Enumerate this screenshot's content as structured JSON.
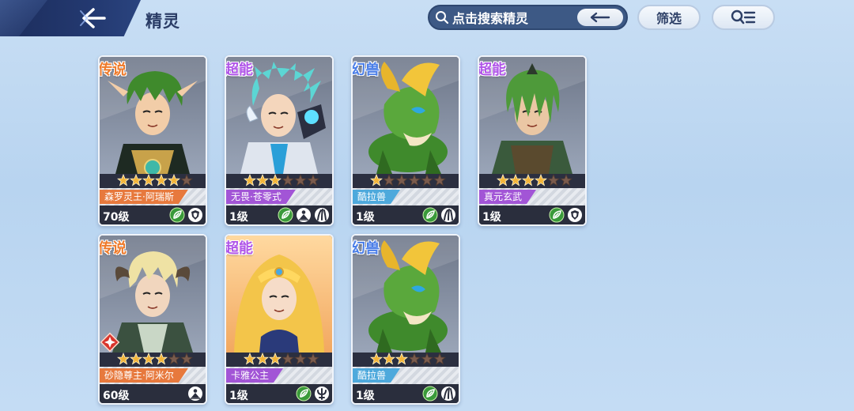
{
  "header": {
    "title": "精灵"
  },
  "search": {
    "placeholder": "点击搜索精灵"
  },
  "buttons": {
    "filter": "筛选"
  },
  "colors": {
    "legend": "#ee7a2a",
    "super": "#b055e8",
    "beast": "#4a7ee8",
    "name_orange": "#e7793d",
    "name_purple": "#a255d6",
    "name_cyan": "#4ea9dc",
    "star_gold": "#f3b53a",
    "star_dim": "#7a5b4d"
  },
  "cards": [
    {
      "rarity": "传说",
      "rarity_type": "legend",
      "name": "森罗灵王·阿瑞斯",
      "level": "70级",
      "stars": 5,
      "max_stars": 6,
      "art": "green-hair-hero",
      "badges": [
        "grass-element-icon",
        "shield-icon"
      ]
    },
    {
      "rarity": "超能",
      "rarity_type": "super",
      "name": "无畏·苍零式",
      "level": "1级",
      "stars": 3,
      "max_stars": 6,
      "art": "cyan-hair-cyborg",
      "badges": [
        "grass-element-icon",
        "person-mark-icon",
        "claw-icon"
      ]
    },
    {
      "rarity": "幻兽",
      "rarity_type": "beast",
      "name": "酷拉兽",
      "level": "1级",
      "stars": 1,
      "max_stars": 6,
      "art": "green-beast",
      "badges": [
        "grass-element-icon",
        "claw-icon"
      ]
    },
    {
      "rarity": "超能",
      "rarity_type": "super",
      "name": "真元玄武",
      "level": "1级",
      "stars": 4,
      "max_stars": 6,
      "art": "green-hair-warrior",
      "badges": [
        "grass-element-icon",
        "shield-icon"
      ]
    },
    {
      "rarity": "传说",
      "rarity_type": "legend",
      "name": "砂隐尊主·阿米尔",
      "level": "60级",
      "stars": 4,
      "max_stars": 6,
      "art": "blonde-horned",
      "badges": [
        "person-mark-icon"
      ],
      "red_badge": true
    },
    {
      "rarity": "超能",
      "rarity_type": "super",
      "name": "卡雅公主",
      "level": "1级",
      "stars": 3,
      "max_stars": 6,
      "art": "blonde-princess",
      "badges": [
        "grass-element-icon",
        "trident-icon"
      ]
    },
    {
      "rarity": "幻兽",
      "rarity_type": "beast",
      "name": "酷拉兽",
      "level": "1级",
      "stars": 3,
      "max_stars": 6,
      "art": "green-beast",
      "badges": [
        "grass-element-icon",
        "claw-icon"
      ]
    }
  ]
}
